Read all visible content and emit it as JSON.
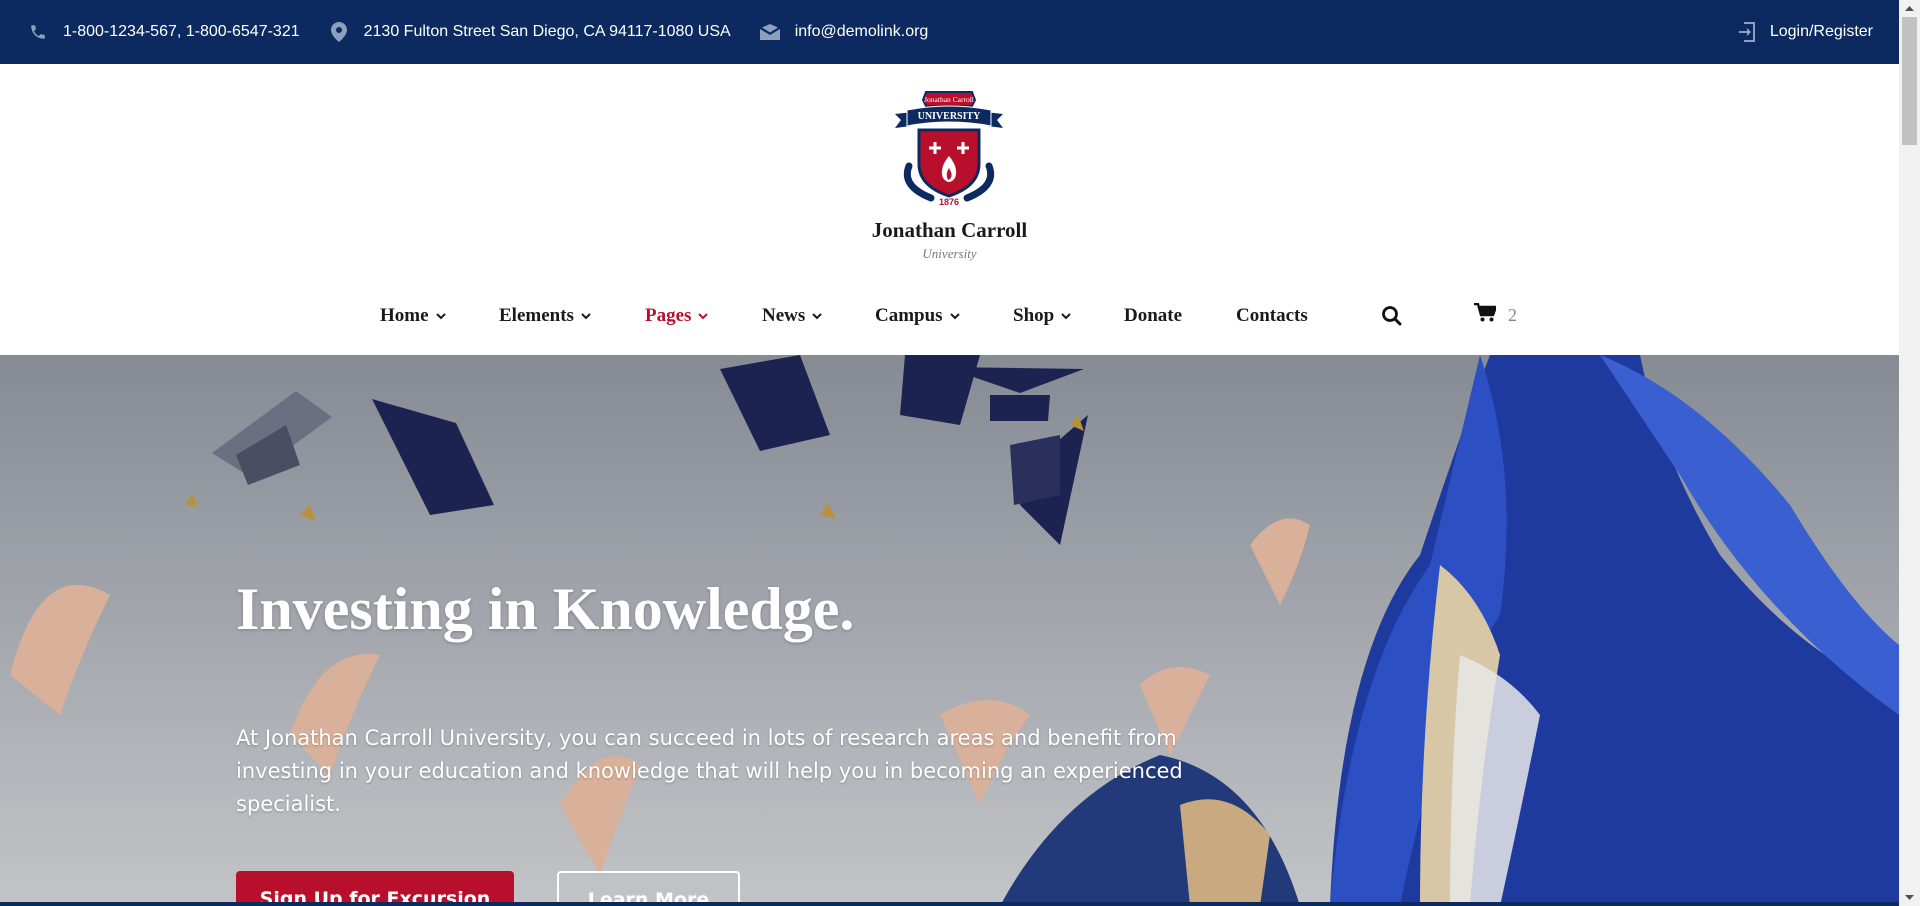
{
  "topbar": {
    "phone": "1-800-1234-567, 1-800-6547-321",
    "address": "2130 Fulton Street San Diego, CA 94117-1080 USA",
    "email": "info@demolink.org",
    "login": "Login/Register",
    "icons": [
      "phone-icon",
      "location-pin-icon",
      "envelope-icon",
      "login-icon"
    ]
  },
  "brand": {
    "logo_banner": "Jonathan Carroll",
    "logo_ribbon": "UNIVERSITY",
    "logo_year": "1876",
    "name": "Jonathan Carroll",
    "subtitle": "University"
  },
  "nav": {
    "items": [
      {
        "label": "Home",
        "dropdown": true
      },
      {
        "label": "Elements",
        "dropdown": true
      },
      {
        "label": "Pages",
        "dropdown": true,
        "active": true
      },
      {
        "label": "News",
        "dropdown": true
      },
      {
        "label": "Campus",
        "dropdown": true
      },
      {
        "label": "Shop",
        "dropdown": true
      },
      {
        "label": "Donate",
        "dropdown": false
      },
      {
        "label": "Contacts",
        "dropdown": false
      }
    ],
    "cart_count": "2"
  },
  "hero": {
    "title": "Investing in Knowledge.",
    "text": "At Jonathan Carroll University, you can succeed in lots of research areas and benefit from investing in your education and knowledge that will help you in becoming an experienced specialist.",
    "primary_button": "Sign Up for Excursion",
    "secondary_button": "Learn More"
  },
  "colors": {
    "navy": "#0c2a5f",
    "accent_red": "#b8102c",
    "text_dark": "#1a1a1a"
  }
}
